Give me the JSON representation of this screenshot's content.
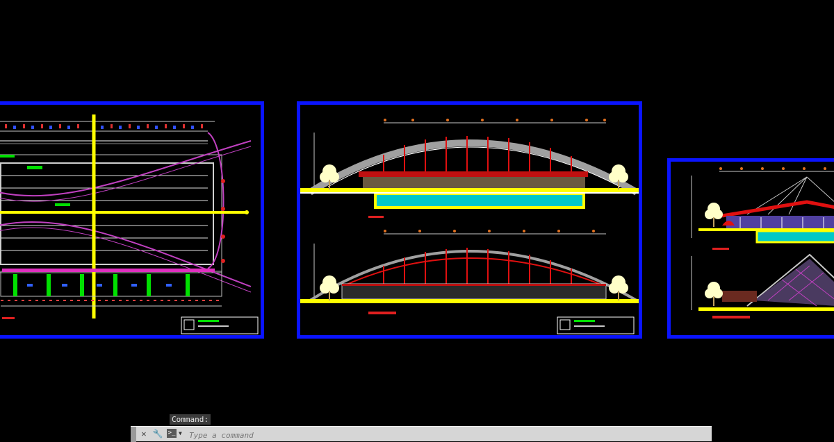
{
  "command_line": {
    "history_text": "Command:",
    "input_placeholder": "Type a command",
    "icons": [
      "close-icon",
      "wrench-icon",
      "command-prompt-icon",
      "chevron-down-icon"
    ]
  },
  "drawing_sheets": [
    {
      "name": "floor-plan",
      "border_color": "#0a14ff"
    },
    {
      "name": "elevations",
      "border_color": "#0a14ff"
    },
    {
      "name": "sections",
      "border_color": "#0a14ff"
    }
  ],
  "colors": {
    "background": "#000000",
    "sheet_border": "#0a14ff",
    "axis_line": "#ffff00",
    "pool_water": "#00c8c8",
    "roof_arc": "#a0a0a0",
    "structure_red": "#e01010",
    "lane_magenta": "#c040c0",
    "green_column": "#00e000",
    "command_bar": "#d6d6d6"
  }
}
